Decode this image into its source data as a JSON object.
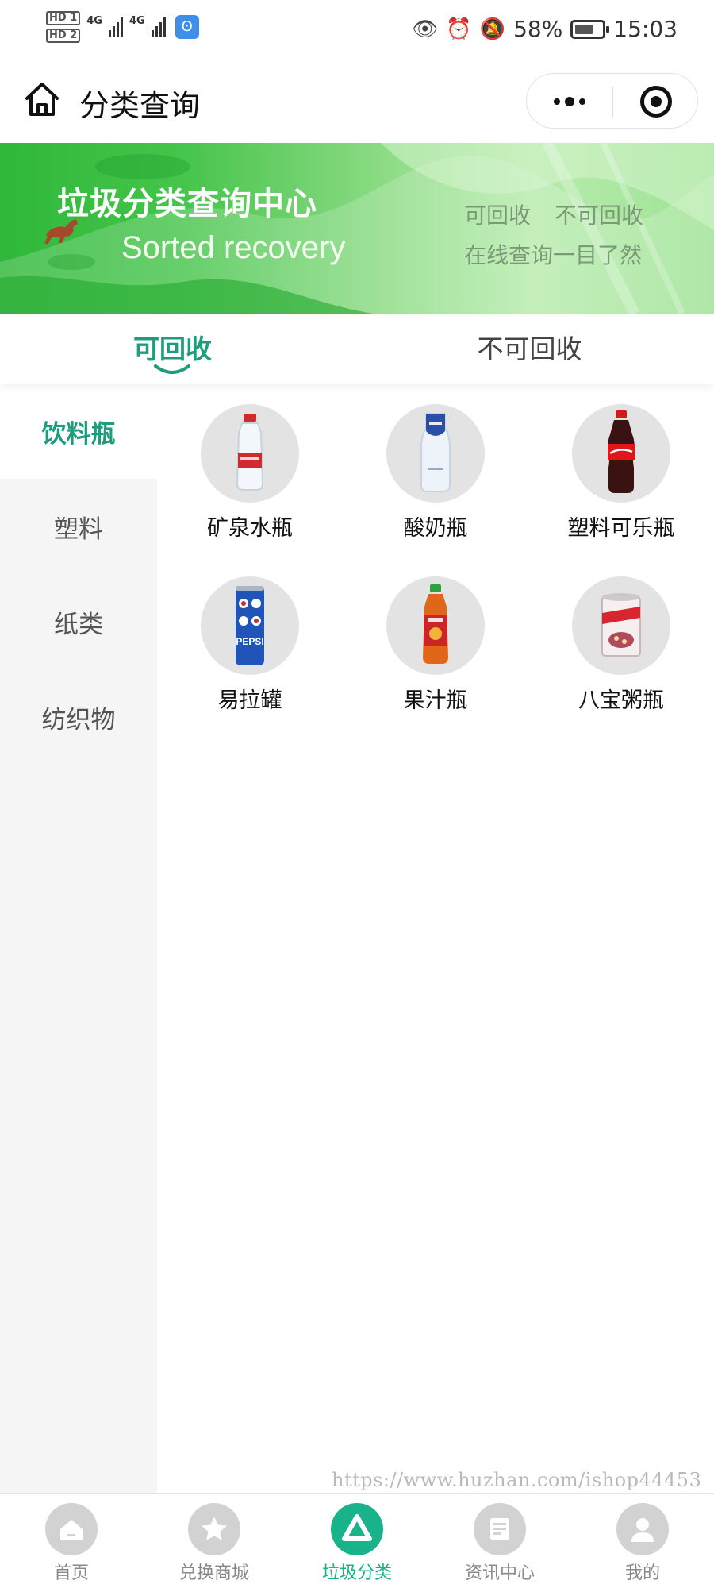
{
  "status_bar": {
    "sim1": "HD 1",
    "sim2": "HD 2",
    "net1": "4G",
    "net2": "4G",
    "battery_percent": "58%",
    "time": "15:03"
  },
  "nav": {
    "title": "分类查询"
  },
  "banner": {
    "title": "垃圾分类查询中心",
    "subtitle": "Sorted recovery",
    "right_line1_a": "可回收",
    "right_line1_b": "不可回收",
    "right_line2": "在线查询一目了然"
  },
  "tabs": [
    {
      "label": "可回收",
      "active": true
    },
    {
      "label": "不可回收",
      "active": false
    }
  ],
  "sidebar": {
    "items": [
      {
        "label": "饮料瓶",
        "active": true
      },
      {
        "label": "塑料",
        "active": false
      },
      {
        "label": "纸类",
        "active": false
      },
      {
        "label": "纺织物",
        "active": false
      }
    ]
  },
  "items": [
    {
      "label": "矿泉水瓶",
      "image": "water-bottle-image"
    },
    {
      "label": "酸奶瓶",
      "image": "yogurt-bottle-image"
    },
    {
      "label": "塑料可乐瓶",
      "image": "cola-bottle-image"
    },
    {
      "label": "易拉罐",
      "image": "pepsi-can-image",
      "can_text": "PEPSI"
    },
    {
      "label": "果汁瓶",
      "image": "juice-bottle-image"
    },
    {
      "label": "八宝粥瓶",
      "image": "porridge-can-image"
    }
  ],
  "watermark": "https://www.huzhan.com/ishop44453",
  "tabbar": [
    {
      "label": "首页",
      "icon": "home-icon",
      "active": false
    },
    {
      "label": "兑换商城",
      "icon": "star-icon",
      "active": false
    },
    {
      "label": "垃圾分类",
      "icon": "recycle-icon",
      "active": true
    },
    {
      "label": "资讯中心",
      "icon": "news-icon",
      "active": false
    },
    {
      "label": "我的",
      "icon": "user-icon",
      "active": false
    }
  ],
  "colors": {
    "accent": "#1d9d7d",
    "tab_active": "#19b38b",
    "banner_green": "#2fb83a"
  }
}
